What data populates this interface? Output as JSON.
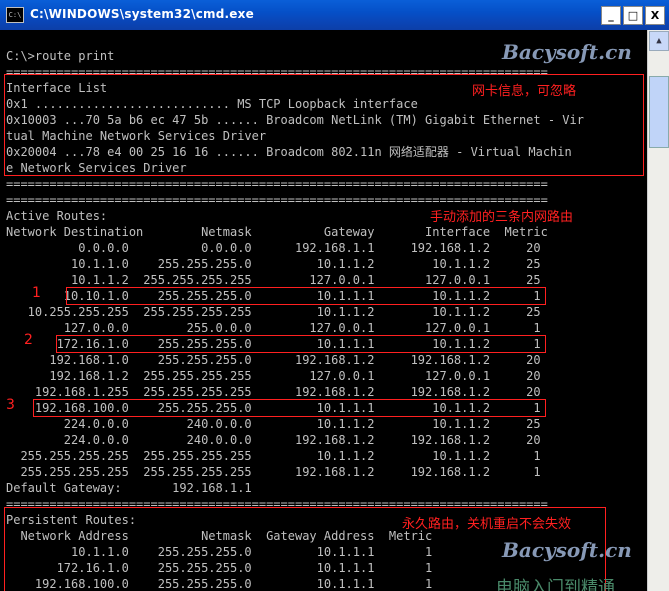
{
  "window": {
    "title": "C:\\WINDOWS\\system32\\cmd.exe",
    "icon": "cmd-icon"
  },
  "controls": {
    "minimize": "_",
    "maximize": "□",
    "close": "X"
  },
  "console": {
    "lines": [
      "C:\\>route print",
      "===========================================================================",
      "Interface List",
      "0x1 ........................... MS TCP Loopback interface",
      "0x10003 ...70 5a b6 ec 47 5b ...... Broadcom NetLink (TM) Gigabit Ethernet - Vir",
      "tual Machine Network Services Driver",
      "0x20004 ...78 e4 00 25 16 16 ...... Broadcom 802.11n 网络适配器 - Virtual Machin",
      "e Network Services Driver",
      "===========================================================================",
      "===========================================================================",
      "Active Routes:",
      "Network Destination        Netmask          Gateway       Interface  Metric",
      "          0.0.0.0          0.0.0.0      192.168.1.1     192.168.1.2     20",
      "         10.1.1.0    255.255.255.0         10.1.1.2        10.1.1.2     25",
      "         10.1.1.2  255.255.255.255        127.0.0.1       127.0.0.1     25",
      "        10.10.1.0    255.255.255.0         10.1.1.1        10.1.1.2      1",
      "   10.255.255.255  255.255.255.255         10.1.1.2        10.1.1.2     25",
      "        127.0.0.0        255.0.0.0        127.0.0.1       127.0.0.1      1",
      "       172.16.1.0    255.255.255.0         10.1.1.1        10.1.1.2      1",
      "      192.168.1.0    255.255.255.0      192.168.1.2     192.168.1.2     20",
      "      192.168.1.2  255.255.255.255        127.0.0.1       127.0.0.1     20",
      "    192.168.1.255  255.255.255.255      192.168.1.2     192.168.1.2     20",
      "    192.168.100.0    255.255.255.0         10.1.1.1        10.1.1.2      1",
      "        224.0.0.0        240.0.0.0         10.1.1.2        10.1.1.2     25",
      "        224.0.0.0        240.0.0.0      192.168.1.2     192.168.1.2     20",
      "  255.255.255.255  255.255.255.255         10.1.1.2        10.1.1.2      1",
      "  255.255.255.255  255.255.255.255      192.168.1.2     192.168.1.2      1",
      "Default Gateway:       192.168.1.1",
      "===========================================================================",
      "Persistent Routes:",
      "  Network Address          Netmask  Gateway Address  Metric",
      "         10.1.1.0    255.255.255.0         10.1.1.1       1",
      "       172.16.1.0    255.255.255.0         10.1.1.1       1",
      "    192.168.100.0    255.255.255.0         10.1.1.1       1"
    ]
  },
  "annotations": {
    "nic_info": "网卡信息，可忽略",
    "manual_routes": "手动添加的三条内网路由",
    "persistent": "永久路由，关机重启不会失效",
    "n1": "1",
    "n2": "2",
    "n3": "3"
  },
  "watermarks": {
    "top": "Bacysoft.cn",
    "bottom": "Bacysoft.cn",
    "cn": "电脑入门到精通"
  },
  "colors": {
    "titlebar": "#0550c8",
    "console_bg": "#000000",
    "console_text": "#c0c0c0",
    "annotation": "#ff2020"
  }
}
